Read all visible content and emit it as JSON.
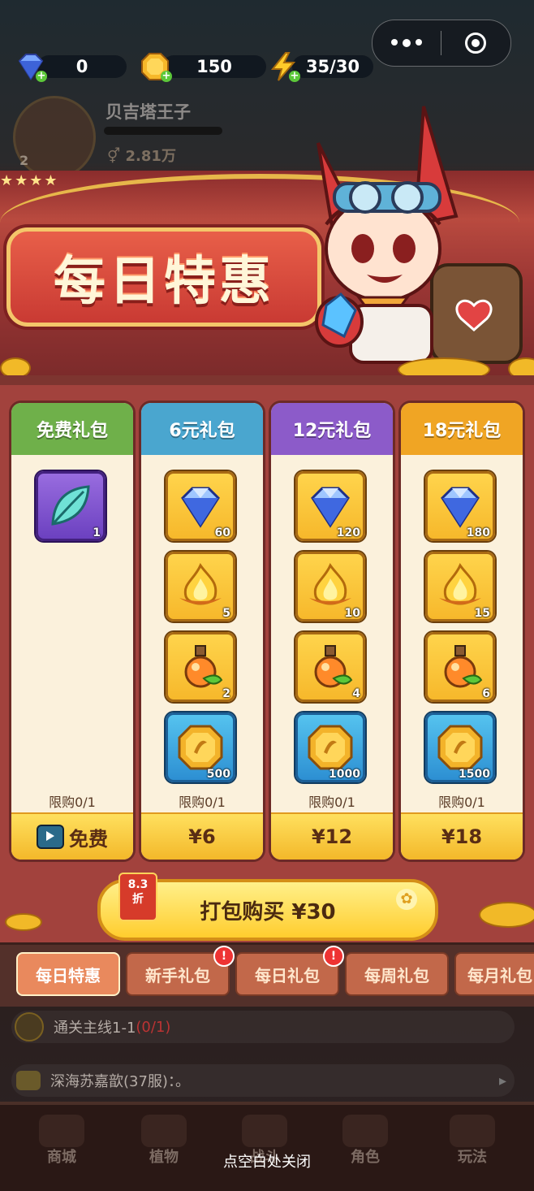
{
  "currency": {
    "diamond": "0",
    "gold": "150",
    "energy": "35/30"
  },
  "player": {
    "name": "贝吉塔王子",
    "power": "2.81万",
    "level": "2"
  },
  "banner": {
    "title": "每日特惠"
  },
  "packs": [
    {
      "name": "免费礼包",
      "header_color": "#6fb04a",
      "items": [
        {
          "icon": "leaf-icon",
          "count": "1",
          "frame": "purple"
        }
      ],
      "limit": "限购0/1",
      "price": "免费"
    },
    {
      "name": "6元礼包",
      "header_color": "#4aa6cf",
      "items": [
        {
          "icon": "diamond-icon",
          "count": "60",
          "frame": "gold"
        },
        {
          "icon": "flame-icon",
          "count": "5",
          "frame": "gold"
        },
        {
          "icon": "potion-icon",
          "count": "2",
          "frame": "gold"
        },
        {
          "icon": "coin-icon",
          "count": "500",
          "frame": "blue"
        }
      ],
      "limit": "限购0/1",
      "price": "¥6"
    },
    {
      "name": "12元礼包",
      "header_color": "#8c5bc9",
      "items": [
        {
          "icon": "diamond-icon",
          "count": "120",
          "frame": "gold"
        },
        {
          "icon": "flame-icon",
          "count": "10",
          "frame": "gold"
        },
        {
          "icon": "potion-icon",
          "count": "4",
          "frame": "gold"
        },
        {
          "icon": "coin-icon",
          "count": "1000",
          "frame": "blue"
        }
      ],
      "limit": "限购0/1",
      "price": "¥12"
    },
    {
      "name": "18元礼包",
      "header_color": "#f0a524",
      "items": [
        {
          "icon": "diamond-icon",
          "count": "180",
          "frame": "gold"
        },
        {
          "icon": "flame-icon",
          "count": "15",
          "frame": "gold"
        },
        {
          "icon": "potion-icon",
          "count": "6",
          "frame": "gold"
        },
        {
          "icon": "coin-icon",
          "count": "1500",
          "frame": "blue"
        }
      ],
      "limit": "限购0/1",
      "price": "¥18"
    }
  ],
  "bundle": {
    "discount_top": "8.3",
    "discount_bottom": "折",
    "label": "打包购买 ¥30"
  },
  "tabs": [
    {
      "label": "每日特惠",
      "active": true,
      "badge": ""
    },
    {
      "label": "新手礼包",
      "active": false,
      "badge": "!"
    },
    {
      "label": "每日礼包",
      "active": false,
      "badge": "!"
    },
    {
      "label": "每周礼包",
      "active": false,
      "badge": ""
    },
    {
      "label": "每月礼包",
      "active": false,
      "badge": ""
    }
  ],
  "quest": {
    "text": "通关主线1-1",
    "progress": "(0/1)"
  },
  "chat": {
    "text": "深海苏嘉歆(37服)：。"
  },
  "bottom_nav": [
    "商城",
    "植物",
    "战斗",
    "角色",
    "玩法"
  ],
  "close_hint": "点空白处关闭"
}
